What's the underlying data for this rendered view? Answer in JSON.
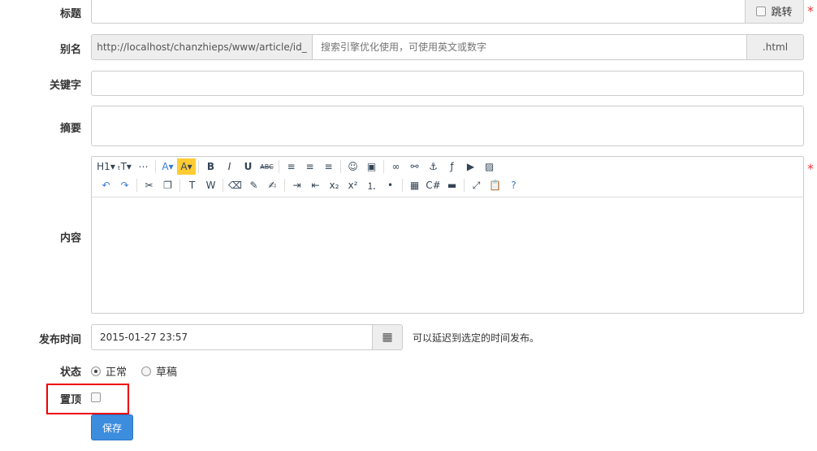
{
  "labels": {
    "title": "标题",
    "alias": "别名",
    "keywords": "关键字",
    "summary": "摘要",
    "content": "内容",
    "publish_time": "发布时间",
    "status": "状态",
    "top": "置顶"
  },
  "title_field": {
    "value": "",
    "jump_label": "跳转"
  },
  "alias_field": {
    "prefix": "http://localhost/chanzhieps/www/article/id_",
    "placeholder": "搜索引擎优化使用，可使用英文或数字",
    "suffix": ".html"
  },
  "keywords_field": {
    "value": ""
  },
  "summary_field": {
    "value": ""
  },
  "editor": {
    "toolbar_row1": [
      {
        "icon": "heading-icon",
        "glyph": "H1▾"
      },
      {
        "icon": "font-size-icon",
        "glyph": "ₜT▾"
      },
      {
        "icon": "horizontal-rule-icon",
        "glyph": "⋯"
      },
      {
        "sep": true
      },
      {
        "icon": "font-color-icon",
        "glyph": "A▾"
      },
      {
        "icon": "highlight-color-icon",
        "glyph": "A▾"
      },
      {
        "sep": true
      },
      {
        "icon": "bold-icon",
        "glyph": "B"
      },
      {
        "icon": "italic-icon",
        "glyph": "I"
      },
      {
        "icon": "underline-icon",
        "glyph": "U"
      },
      {
        "icon": "strikethrough-icon",
        "glyph": "ABC"
      },
      {
        "sep": true
      },
      {
        "icon": "align-left-icon",
        "glyph": "≡"
      },
      {
        "icon": "align-center-icon",
        "glyph": "≡"
      },
      {
        "icon": "align-right-icon",
        "glyph": "≡"
      },
      {
        "sep": true
      },
      {
        "icon": "emoticon-icon",
        "glyph": "☺"
      },
      {
        "icon": "insert-image-icon",
        "glyph": "▣"
      },
      {
        "sep": true
      },
      {
        "icon": "link-icon",
        "glyph": "∞"
      },
      {
        "icon": "unlink-icon",
        "glyph": "⚯"
      },
      {
        "icon": "anchor-icon",
        "glyph": "⚓"
      },
      {
        "icon": "flash-icon",
        "glyph": "ƒ"
      },
      {
        "icon": "media-icon",
        "glyph": "▶"
      },
      {
        "icon": "image-icon",
        "glyph": "▨"
      }
    ],
    "toolbar_row2": [
      {
        "icon": "undo-icon",
        "glyph": "↶"
      },
      {
        "icon": "redo-icon",
        "glyph": "↷"
      },
      {
        "sep": true
      },
      {
        "icon": "cut-icon",
        "glyph": "✂"
      },
      {
        "icon": "copy-icon",
        "glyph": "❐"
      },
      {
        "sep": true
      },
      {
        "icon": "paste-text-icon",
        "glyph": "T"
      },
      {
        "icon": "paste-word-icon",
        "glyph": "W"
      },
      {
        "sep": true
      },
      {
        "icon": "eraser-icon",
        "glyph": "⌫"
      },
      {
        "icon": "clear-format-icon",
        "glyph": "✎"
      },
      {
        "icon": "quick-format-icon",
        "glyph": "✍"
      },
      {
        "sep": true
      },
      {
        "icon": "indent-icon",
        "glyph": "⇥"
      },
      {
        "icon": "outdent-icon",
        "glyph": "⇤"
      },
      {
        "icon": "subscript-icon",
        "glyph": "x₂"
      },
      {
        "icon": "superscript-icon",
        "glyph": "x²"
      },
      {
        "icon": "ordered-list-icon",
        "glyph": "⒈"
      },
      {
        "icon": "unordered-list-icon",
        "glyph": "•"
      },
      {
        "sep": true
      },
      {
        "icon": "table-icon",
        "glyph": "▦"
      },
      {
        "icon": "code-icon",
        "glyph": "C#"
      },
      {
        "icon": "page-break-icon",
        "glyph": "▬"
      },
      {
        "sep": true
      },
      {
        "icon": "fullscreen-icon",
        "glyph": "⤢"
      },
      {
        "icon": "source-icon",
        "glyph": "📋"
      },
      {
        "icon": "help-icon",
        "glyph": "?"
      }
    ]
  },
  "publish": {
    "value": "2015-01-27 23:57",
    "hint": "可以延迟到选定的时间发布。"
  },
  "status": {
    "options": [
      "正常",
      "草稿"
    ],
    "selected": 0
  },
  "top": {
    "checked": false
  },
  "save_label": "保存",
  "colors": {
    "primary": "#3c8dde",
    "required": "#e33",
    "highlight_box": "#e00"
  }
}
